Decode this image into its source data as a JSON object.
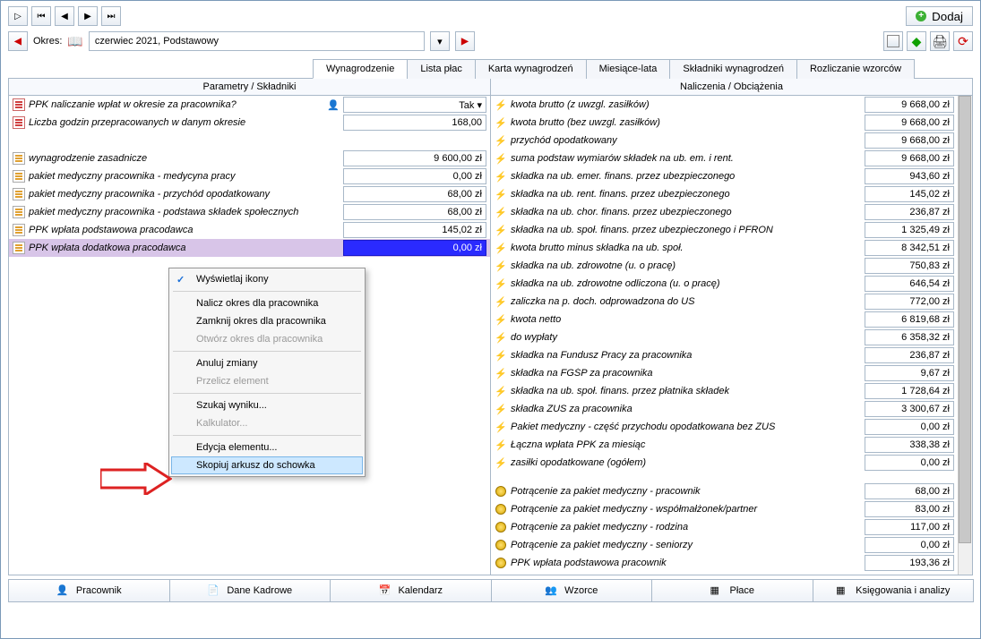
{
  "topbar": {
    "add_label": "Dodaj"
  },
  "period": {
    "label": "Okres:",
    "value": "czerwiec 2021, Podstawowy"
  },
  "tabs": [
    {
      "label": "Wynagrodzenie",
      "u": "y"
    },
    {
      "label": "Lista płac",
      "u": "i"
    },
    {
      "label": "Karta wynagrodzeń",
      "u": "w"
    },
    {
      "label": "Miesiące-lata",
      "u": ""
    },
    {
      "label": "Składniki wynagrodzeń",
      "u": ""
    },
    {
      "label": "Rozliczanie wzorców",
      "u": ""
    }
  ],
  "left_header": "Parametry / Składniki",
  "right_header": "Naliczenia / Obciążenia",
  "left_rows": [
    {
      "icon": "red",
      "label": "PPK naliczanie wpłat w okresie za pracownika?",
      "value": "Tak ▾",
      "user": true
    },
    {
      "icon": "red",
      "label": "Liczba godzin przepracowanych w danym okresie",
      "value": "168,00"
    },
    {
      "icon": "doc",
      "label": "wynagrodzenie zasadnicze",
      "value": "9 600,00 zł",
      "gap": true
    },
    {
      "icon": "doc",
      "label": "pakiet medyczny pracownika - medycyna pracy",
      "value": "0,00 zł"
    },
    {
      "icon": "doc",
      "label": "pakiet medyczny pracownika - przychód opodatkowany",
      "value": "68,00 zł"
    },
    {
      "icon": "doc",
      "label": "pakiet medyczny pracownika - podstawa składek społecznych",
      "value": "68,00 zł"
    },
    {
      "icon": "doc",
      "label": "PPK wpłata podstawowa pracodawca",
      "value": "145,02 zł"
    },
    {
      "icon": "doc",
      "label": "PPK wpłata dodatkowa pracodawca",
      "value": "0,00 zł",
      "sel": true
    }
  ],
  "right_rows": [
    {
      "icon": "bolt",
      "label": "kwota brutto (z uwzgl. zasiłków)",
      "value": "9 668,00 zł"
    },
    {
      "icon": "bolt",
      "label": "kwota brutto (bez uwzgl. zasiłków)",
      "value": "9 668,00 zł"
    },
    {
      "icon": "bolt",
      "label": "przychód opodatkowany",
      "value": "9 668,00 zł"
    },
    {
      "icon": "bolt",
      "label": "suma podstaw wymiarów składek na ub. em. i rent.",
      "value": "9 668,00 zł"
    },
    {
      "icon": "bolt",
      "label": "składka na ub. emer. finans. przez ubezpieczonego",
      "value": "943,60 zł"
    },
    {
      "icon": "bolt",
      "label": "składka na ub. rent. finans. przez ubezpieczonego",
      "value": "145,02 zł"
    },
    {
      "icon": "bolt",
      "label": "składka na ub. chor. finans. przez ubezpieczonego",
      "value": "236,87 zł"
    },
    {
      "icon": "bolt",
      "label": "składka na ub. społ. finans. przez ubezpieczonego i PFRON",
      "value": "1 325,49 zł"
    },
    {
      "icon": "bolt",
      "label": "kwota brutto minus składka na ub. społ.",
      "value": "8 342,51 zł"
    },
    {
      "icon": "bolt",
      "label": "składka na ub. zdrowotne (u. o pracę)",
      "value": "750,83 zł"
    },
    {
      "icon": "bolt",
      "label": "składka na ub. zdrowotne odliczona (u. o pracę)",
      "value": "646,54 zł"
    },
    {
      "icon": "bolt",
      "label": "zaliczka na p. doch. odprowadzona do US",
      "value": "772,00 zł"
    },
    {
      "icon": "bolt",
      "label": "kwota netto",
      "value": "6 819,68 zł"
    },
    {
      "icon": "bolt",
      "label": "do wypłaty",
      "value": "6 358,32 zł"
    },
    {
      "icon": "bolt",
      "label": "składka na Fundusz Pracy za pracownika",
      "value": "236,87 zł"
    },
    {
      "icon": "bolt",
      "label": "składka na FGŚP za pracownika",
      "value": "9,67 zł"
    },
    {
      "icon": "bolt",
      "label": "składka na ub. społ. finans. przez płatnika składek",
      "value": "1 728,64 zł"
    },
    {
      "icon": "bolt",
      "label": "składka ZUS za pracownika",
      "value": "3 300,67 zł"
    },
    {
      "icon": "bolt",
      "label": "Pakiet medyczny - część przychodu opodatkowana bez ZUS",
      "value": "0,00 zł"
    },
    {
      "icon": "bolt",
      "label": "Łączna wpłata PPK za miesiąc",
      "value": "338,38 zł"
    },
    {
      "icon": "bolt",
      "label": "zasiłki opodatkowane (ogółem)",
      "value": "0,00 zł"
    },
    {
      "icon": "coin",
      "label": "Potrącenie za pakiet medyczny - pracownik",
      "value": "68,00 zł",
      "gap": true
    },
    {
      "icon": "coin",
      "label": "Potrącenie za pakiet medyczny - współmałżonek/partner",
      "value": "83,00 zł"
    },
    {
      "icon": "coin",
      "label": "Potrącenie za pakiet medyczny - rodzina",
      "value": "117,00 zł"
    },
    {
      "icon": "coin",
      "label": "Potrącenie za pakiet medyczny - seniorzy",
      "value": "0,00 zł"
    },
    {
      "icon": "coin",
      "label": "PPK wpłata podstawowa pracownik",
      "value": "193,36 zł"
    }
  ],
  "context_menu": [
    {
      "label": "Wyświetlaj ikony",
      "checked": true
    },
    {
      "sep": true
    },
    {
      "label": "Nalicz okres dla pracownika"
    },
    {
      "label": "Zamknij okres dla pracownika"
    },
    {
      "label": "Otwórz okres dla pracownika",
      "disabled": true
    },
    {
      "sep": true
    },
    {
      "label": "Anuluj zmiany"
    },
    {
      "label": "Przelicz element",
      "disabled": true
    },
    {
      "sep": true
    },
    {
      "label": "Szukaj wyniku..."
    },
    {
      "label": "Kalkulator...",
      "disabled": true
    },
    {
      "sep": true
    },
    {
      "label": "Edycja elementu..."
    },
    {
      "label": "Skopiuj arkusz do schowka",
      "hover": true
    }
  ],
  "bottom_tabs": [
    {
      "label": "Pracownik",
      "icon": "👤",
      "u": "P"
    },
    {
      "label": "Dane Kadrowe",
      "icon": "📄",
      "u": "K"
    },
    {
      "label": "Kalendarz",
      "icon": "📅",
      "u": "a"
    },
    {
      "label": "Wzorce",
      "icon": "👥",
      "u": "W"
    },
    {
      "label": "Płace",
      "icon": "▦",
      "u": "ł"
    },
    {
      "label": "Księgowania i analizy",
      "icon": "▦",
      "u": ""
    }
  ]
}
